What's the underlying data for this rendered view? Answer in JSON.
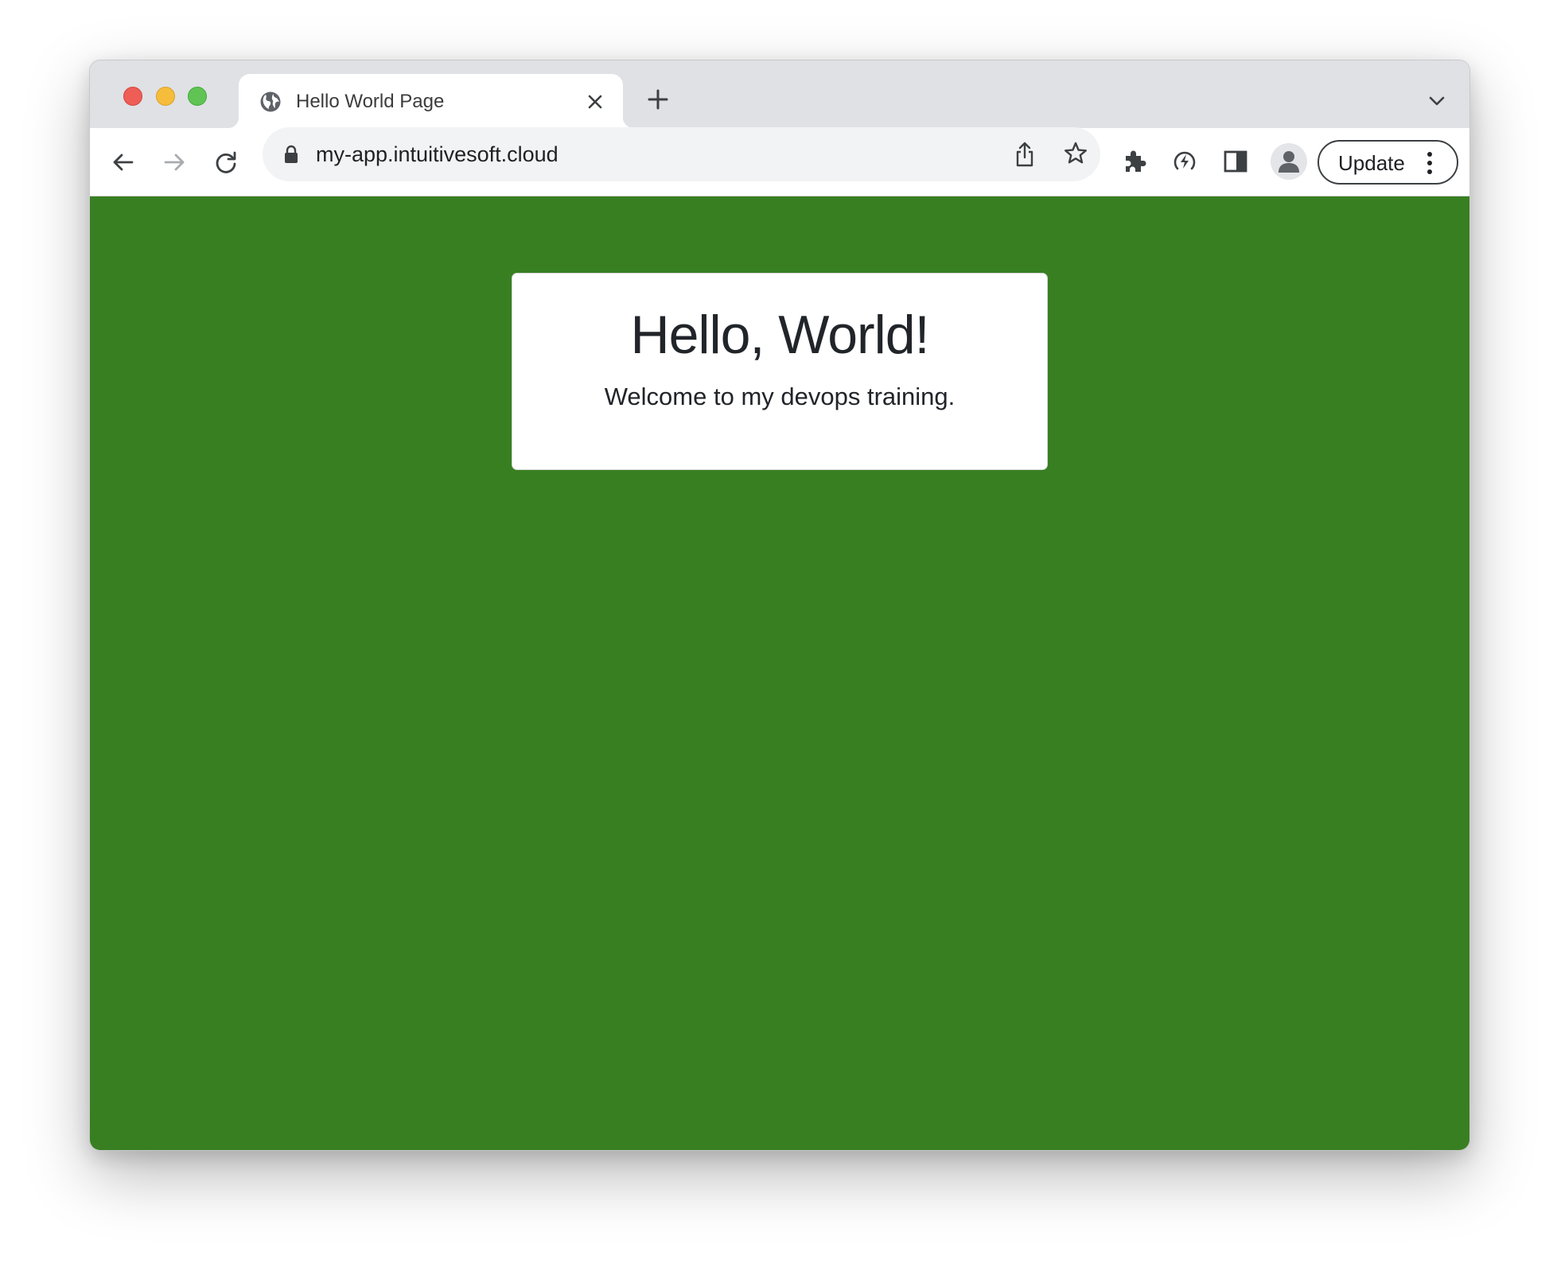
{
  "browser": {
    "tab": {
      "title": "Hello World Page"
    },
    "address_bar": {
      "url": "my-app.intuitivesoft.cloud"
    },
    "toolbar": {
      "update_label": "Update"
    },
    "icons": {
      "favicon": "globe-icon",
      "tab_close": "close-icon",
      "new_tab": "plus-icon",
      "tab_search": "chevron-down-icon",
      "back": "arrow-left-icon",
      "forward": "arrow-right-icon",
      "reload": "reload-icon",
      "lock": "lock-icon",
      "share": "share-icon",
      "bookmark": "star-icon",
      "extensions": "puzzle-icon",
      "performance": "performance-icon",
      "side_panel": "side-panel-icon",
      "profile": "person-icon",
      "menu": "kebab-icon"
    }
  },
  "page": {
    "background_color": "#387f22",
    "card": {
      "title": "Hello, World!",
      "subtitle": "Welcome to my devops training."
    }
  }
}
